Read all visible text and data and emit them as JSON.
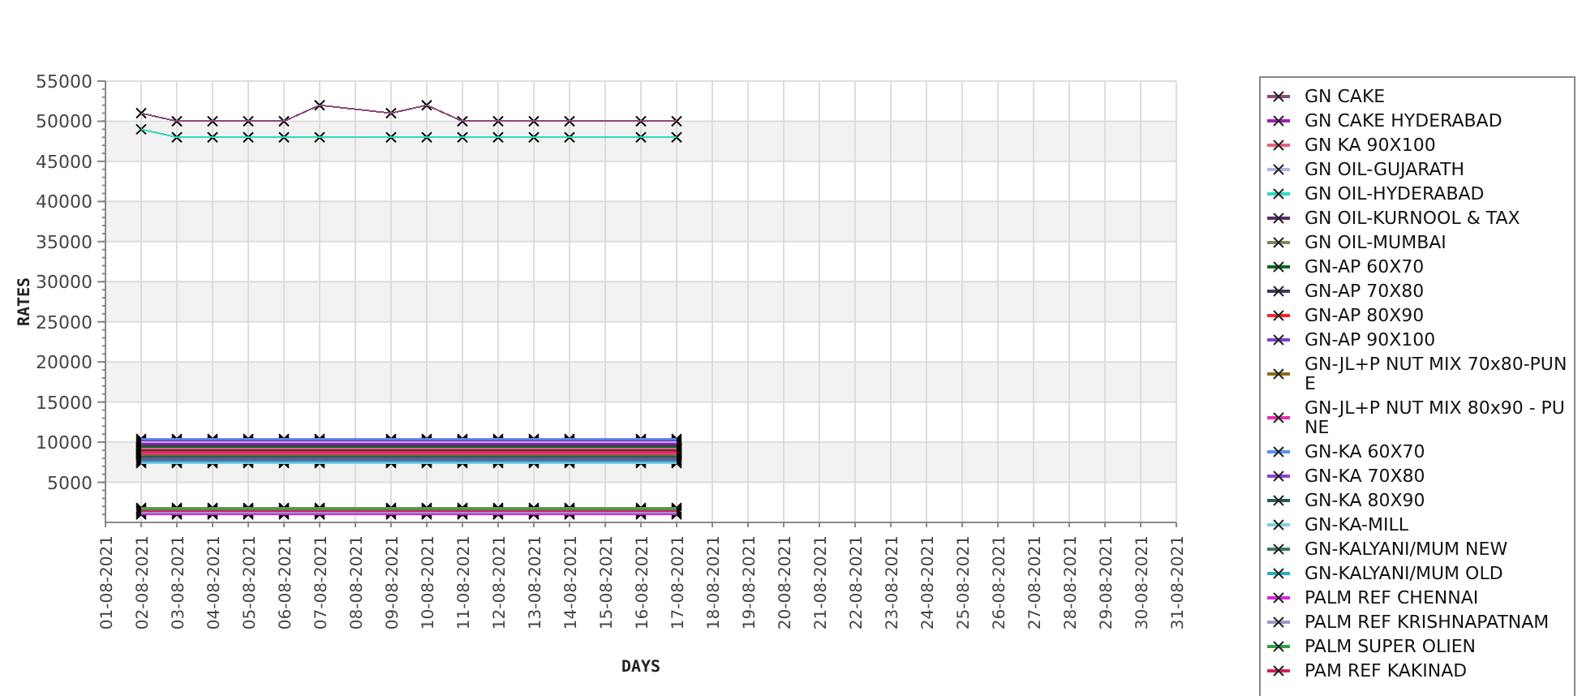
{
  "chart": {
    "chart_data": {
      "type": "line",
      "xlabel": "DAYS",
      "ylabel": "RATES",
      "ylim": [
        0,
        55000
      ],
      "yticks": [
        5000,
        10000,
        15000,
        20000,
        25000,
        30000,
        35000,
        40000,
        45000,
        50000,
        55000
      ],
      "grid": true,
      "categories": [
        "01-08-2021",
        "02-08-2021",
        "03-08-2021",
        "04-08-2021",
        "05-08-2021",
        "06-08-2021",
        "07-08-2021",
        "08-08-2021",
        "09-08-2021",
        "10-08-2021",
        "11-08-2021",
        "12-08-2021",
        "13-08-2021",
        "14-08-2021",
        "15-08-2021",
        "16-08-2021",
        "17-08-2021",
        "18-08-2021",
        "19-08-2021",
        "20-08-2021",
        "21-08-2021",
        "22-08-2021",
        "23-08-2021",
        "24-08-2021",
        "25-08-2021",
        "26-08-2021",
        "27-08-2021",
        "28-08-2021",
        "29-08-2021",
        "30-08-2021",
        "31-08-2021"
      ],
      "series": [
        {
          "name": "GN CAKE",
          "color": "#8a4a78",
          "marker": "x",
          "values": [
            null,
            51000,
            50000,
            50000,
            50000,
            50000,
            52000,
            null,
            51000,
            52000,
            50000,
            50000,
            50000,
            50000,
            null,
            50000,
            50000,
            null,
            null,
            null,
            null,
            null,
            null,
            null,
            null,
            null,
            null,
            null,
            null,
            null,
            null
          ]
        },
        {
          "name": "GN CAKE HYDERABAD",
          "color": "#9b1fb0",
          "marker": "x",
          "values": [
            null,
            9800,
            9800,
            9800,
            9800,
            9800,
            9800,
            null,
            9800,
            9800,
            9800,
            9800,
            9800,
            9800,
            null,
            9800,
            9800,
            null,
            null,
            null,
            null,
            null,
            null,
            null,
            null,
            null,
            null,
            null,
            null,
            null,
            null
          ]
        },
        {
          "name": "GN KA 90X100",
          "color": "#e8607a",
          "marker": "x",
          "values": [
            null,
            9200,
            9200,
            9200,
            9200,
            9200,
            9200,
            null,
            9200,
            9200,
            9200,
            9200,
            9200,
            9200,
            null,
            9200,
            9200,
            null,
            null,
            null,
            null,
            null,
            null,
            null,
            null,
            null,
            null,
            null,
            null,
            null,
            null
          ]
        },
        {
          "name": "GN OIL-GUJARATH",
          "color": "#a8b8e0",
          "marker": "x",
          "values": [
            null,
            10000,
            10000,
            10000,
            10000,
            10000,
            10000,
            null,
            10000,
            10000,
            10000,
            10000,
            10000,
            10000,
            null,
            10000,
            10000,
            null,
            null,
            null,
            null,
            null,
            null,
            null,
            null,
            null,
            null,
            null,
            null,
            null,
            null
          ]
        },
        {
          "name": "GN OIL-HYDERABAD",
          "color": "#30d8c0",
          "marker": "x",
          "values": [
            null,
            49000,
            48000,
            48000,
            48000,
            48000,
            48000,
            null,
            48000,
            48000,
            48000,
            48000,
            48000,
            48000,
            null,
            48000,
            48000,
            null,
            null,
            null,
            null,
            null,
            null,
            null,
            null,
            null,
            null,
            null,
            null,
            null,
            null
          ]
        },
        {
          "name": "GN OIL-KURNOOL & TAX",
          "color": "#5a2a6a",
          "marker": "x",
          "values": [
            null,
            9600,
            9600,
            9600,
            9600,
            9600,
            9600,
            null,
            9600,
            9600,
            9600,
            9600,
            9600,
            9600,
            null,
            9600,
            9600,
            null,
            null,
            null,
            null,
            null,
            null,
            null,
            null,
            null,
            null,
            null,
            null,
            null,
            null
          ]
        },
        {
          "name": "GN OIL-MUMBAI",
          "color": "#7a8a5a",
          "marker": "x",
          "values": [
            null,
            1800,
            1800,
            1800,
            1800,
            1800,
            1800,
            null,
            1800,
            1800,
            1800,
            1800,
            1800,
            1800,
            null,
            1800,
            1800,
            null,
            null,
            null,
            null,
            null,
            null,
            null,
            null,
            null,
            null,
            null,
            null,
            null,
            null
          ]
        },
        {
          "name": "GN-AP 60X70",
          "color": "#0a6a2a",
          "marker": "x",
          "values": [
            null,
            9400,
            9400,
            9400,
            9400,
            9400,
            9400,
            null,
            9400,
            9400,
            9400,
            9400,
            9400,
            9400,
            null,
            9400,
            9400,
            null,
            null,
            null,
            null,
            null,
            null,
            null,
            null,
            null,
            null,
            null,
            null,
            null,
            null
          ]
        },
        {
          "name": "GN-AP 70X80",
          "color": "#3a3a5a",
          "marker": "x",
          "values": [
            null,
            9000,
            9000,
            9000,
            9000,
            9000,
            9000,
            null,
            9000,
            9000,
            9000,
            9000,
            9000,
            9000,
            null,
            9000,
            9000,
            null,
            null,
            null,
            null,
            null,
            null,
            null,
            null,
            null,
            null,
            null,
            null,
            null,
            null
          ]
        },
        {
          "name": "GN-AP 80X90",
          "color": "#ff2020",
          "marker": "x",
          "values": [
            null,
            8800,
            8800,
            8800,
            8800,
            8800,
            8800,
            null,
            8800,
            8800,
            8800,
            8800,
            8800,
            8800,
            null,
            8800,
            8800,
            null,
            null,
            null,
            null,
            null,
            null,
            null,
            null,
            null,
            null,
            null,
            null,
            null,
            null
          ]
        },
        {
          "name": "GN-AP 90X100",
          "color": "#7a40d0",
          "marker": "x",
          "values": [
            null,
            10200,
            10200,
            10200,
            10200,
            10200,
            10200,
            null,
            10200,
            10200,
            10200,
            10200,
            10200,
            10200,
            null,
            10200,
            10200,
            null,
            null,
            null,
            null,
            null,
            null,
            null,
            null,
            null,
            null,
            null,
            null,
            null,
            null
          ]
        },
        {
          "name": "GN-JL+P NUT MIX 70x80-PUNE",
          "color": "#8a6a20",
          "marker": "x",
          "values": [
            null,
            8400,
            8400,
            8400,
            8400,
            8400,
            8400,
            null,
            8400,
            8400,
            8400,
            8400,
            8400,
            8400,
            null,
            8400,
            8400,
            null,
            null,
            null,
            null,
            null,
            null,
            null,
            null,
            null,
            null,
            null,
            null,
            null,
            null
          ]
        },
        {
          "name": "GN-JL+P NUT MIX 80x90 - PUNE",
          "color": "#e030b0",
          "marker": "x",
          "values": [
            null,
            8600,
            8600,
            8600,
            8600,
            8600,
            8600,
            null,
            8600,
            8600,
            8600,
            8600,
            8600,
            8600,
            null,
            8600,
            8600,
            null,
            null,
            null,
            null,
            null,
            null,
            null,
            null,
            null,
            null,
            null,
            null,
            null,
            null
          ]
        },
        {
          "name": "GN-KA 60X70",
          "color": "#5a90f0",
          "marker": "x",
          "values": [
            null,
            10400,
            10400,
            10400,
            10400,
            10400,
            10400,
            null,
            10400,
            10400,
            10400,
            10400,
            10400,
            10400,
            null,
            10400,
            10400,
            null,
            null,
            null,
            null,
            null,
            null,
            null,
            null,
            null,
            null,
            null,
            null,
            null,
            null
          ]
        },
        {
          "name": "GN-KA 70X80",
          "color": "#8a40d0",
          "marker": "x",
          "values": [
            null,
            7800,
            7800,
            7800,
            7800,
            7800,
            7800,
            null,
            7800,
            7800,
            7800,
            7800,
            7800,
            7800,
            null,
            7800,
            7800,
            null,
            null,
            null,
            null,
            null,
            null,
            null,
            null,
            null,
            null,
            null,
            null,
            null,
            null
          ]
        },
        {
          "name": "GN-KA 80X90",
          "color": "#2a5a5a",
          "marker": "x",
          "values": [
            null,
            8200,
            8200,
            8200,
            8200,
            8200,
            8200,
            null,
            8200,
            8200,
            8200,
            8200,
            8200,
            8200,
            null,
            8200,
            8200,
            null,
            null,
            null,
            null,
            null,
            null,
            null,
            null,
            null,
            null,
            null,
            null,
            null,
            null
          ]
        },
        {
          "name": "GN-KA-MILL",
          "color": "#80d0e0",
          "marker": "x",
          "values": [
            null,
            7400,
            7400,
            7400,
            7400,
            7400,
            7400,
            null,
            7400,
            7400,
            7400,
            7400,
            7400,
            7400,
            null,
            7400,
            7400,
            null,
            null,
            null,
            null,
            null,
            null,
            null,
            null,
            null,
            null,
            null,
            null,
            null,
            null
          ]
        },
        {
          "name": "GN-KALYANI/MUM NEW",
          "color": "#3a7a6a",
          "marker": "x",
          "values": [
            null,
            8000,
            8000,
            8000,
            8000,
            8000,
            8000,
            null,
            8000,
            8000,
            8000,
            8000,
            8000,
            8000,
            null,
            8000,
            8000,
            null,
            null,
            null,
            null,
            null,
            null,
            null,
            null,
            null,
            null,
            null,
            null,
            null,
            null
          ]
        },
        {
          "name": "GN-KALYANI/MUM OLD",
          "color": "#20b0c0",
          "marker": "x",
          "values": [
            null,
            7600,
            7600,
            7600,
            7600,
            7600,
            7600,
            null,
            7600,
            7600,
            7600,
            7600,
            7600,
            7600,
            null,
            7600,
            7600,
            null,
            null,
            null,
            null,
            null,
            null,
            null,
            null,
            null,
            null,
            null,
            null,
            null,
            null
          ]
        },
        {
          "name": "PALM REF CHENNAI",
          "color": "#e020e0",
          "marker": "x",
          "values": [
            null,
            1000,
            1000,
            1000,
            1000,
            1000,
            1000,
            null,
            1000,
            1000,
            1000,
            1000,
            1000,
            1000,
            null,
            1000,
            1000,
            null,
            null,
            null,
            null,
            null,
            null,
            null,
            null,
            null,
            null,
            null,
            null,
            null,
            null
          ]
        },
        {
          "name": "PALM REF KRISHNAPATNAM",
          "color": "#9a9ac8",
          "marker": "x",
          "values": [
            null,
            1200,
            1200,
            1200,
            1200,
            1200,
            1200,
            null,
            1200,
            1200,
            1200,
            1200,
            1200,
            1200,
            null,
            1200,
            1200,
            null,
            null,
            null,
            null,
            null,
            null,
            null,
            null,
            null,
            null,
            null,
            null,
            null,
            null
          ]
        },
        {
          "name": "PALM SUPER OLIEN",
          "color": "#30a040",
          "marker": "x",
          "values": [
            null,
            1600,
            1600,
            1600,
            1600,
            1600,
            1600,
            null,
            1600,
            1600,
            1600,
            1600,
            1600,
            1600,
            null,
            1600,
            1600,
            null,
            null,
            null,
            null,
            null,
            null,
            null,
            null,
            null,
            null,
            null,
            null,
            null,
            null
          ]
        },
        {
          "name": "PAM REF KAKINAD",
          "color": "#d02060",
          "marker": "x",
          "values": [
            null,
            1400,
            1400,
            1400,
            1400,
            1400,
            1400,
            null,
            1400,
            1400,
            1400,
            1400,
            1400,
            1400,
            null,
            1400,
            1400,
            null,
            null,
            null,
            null,
            null,
            null,
            null,
            null,
            null,
            null,
            null,
            null,
            null,
            null
          ]
        }
      ]
    }
  }
}
